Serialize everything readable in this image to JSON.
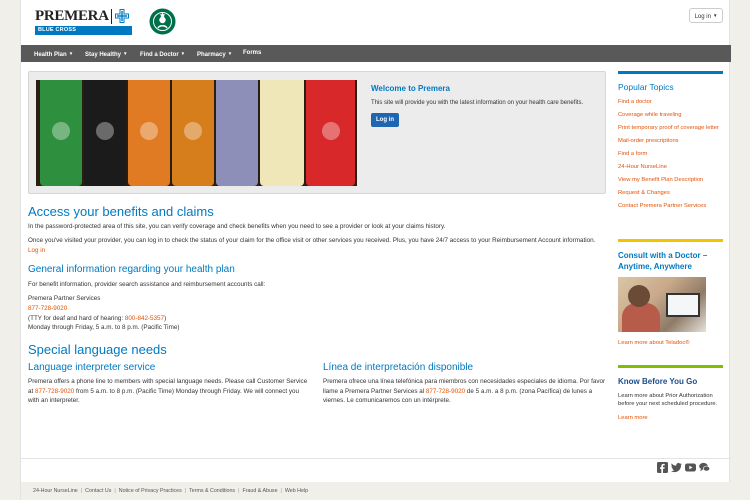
{
  "brand": {
    "name": "PREMERA",
    "band": "BLUE CROSS",
    "blue": "#0079c1",
    "orange": "#e35205",
    "partner_logo": "starbucks-logo"
  },
  "header": {
    "login_label": "Log in"
  },
  "nav": {
    "items": [
      {
        "label": "Health Plan",
        "has_caret": true
      },
      {
        "label": "Stay Healthy",
        "has_caret": true
      },
      {
        "label": "Find a Doctor",
        "has_caret": true
      },
      {
        "label": "Pharmacy",
        "has_caret": true
      },
      {
        "label": "Forms",
        "has_caret": false
      }
    ]
  },
  "hero": {
    "title": "Welcome to Premera",
    "text": "This site will provide you with the latest information on your health care benefits.",
    "button": "Log in"
  },
  "access": {
    "title": "Access your benefits and claims",
    "p1": "In the password-protected area of this site, you can verify coverage and check benefits when you need to see a provider or look at your claims history.",
    "p2": "Once you've visited your provider, you can log in to check the status of your claim for the office visit or other services you received. Plus, you have 24/7 access to your Reimbursement Account information.",
    "link": "Log in"
  },
  "general": {
    "title": "General information regarding your health plan",
    "intro": "For benefit information, provider search assistance and reimbursement accounts call:",
    "org": "Premera Partner Services",
    "phone": "877-728-9020",
    "tty_prefix": "(TTY for deaf and hard of hearing: ",
    "tty_phone": "800-842-5357",
    "tty_suffix": ")",
    "hours": "Monday through Friday, 5 a.m. to 8 p.m. (Pacific Time)"
  },
  "language": {
    "title": "Special language needs",
    "en_title": "Language interpreter service",
    "en_text_1": "Premera offers a phone line to members with special language needs. Please call Customer Service at ",
    "en_phone": "877-728-9020",
    "en_text_2": " from 5 a.m. to 8 p.m. (Pacific Time) Monday through Friday. We will connect you with an interpreter.",
    "es_title": "Línea de interpretación disponible",
    "es_text_1": "Premera ofrece una línea telefónica para miembros con necesidades especiales de idioma. Por favor llame a Premera Partner Services al ",
    "es_phone": "877-728-9020",
    "es_text_2": " de 5 a.m. a 8 p.m. (zona Pacífica) de lunes a viernes. Le comunicaremos con un intérprete."
  },
  "sidebar": {
    "popular_title": "Popular Topics",
    "topics": [
      "Find a doctor",
      "Coverage while traveling",
      "Print temporary proof of coverage letter",
      "Mail-order prescriptions",
      "Find a form",
      "24-Hour NurseLine",
      "View my Benefit Plan Description",
      "Request & Changes",
      "Contact Premera Partner Services"
    ],
    "teladoc_title": "Consult with a Doctor – Anytime, Anywhere",
    "teladoc_link": "Learn more about Teladoc®",
    "know_title": "Know Before You Go",
    "know_text": "Learn more about Prior Authorization before your next scheduled procedure.",
    "know_link": "Learn more"
  },
  "social": [
    "facebook-icon",
    "twitter-icon",
    "youtube-icon",
    "chat-icon"
  ],
  "footer": {
    "links": [
      "24-Hour NurseLine",
      "Contact Us",
      "Notice of Privacy Practices",
      "Terms & Conditions",
      "Fraud & Abuse",
      "Web Help"
    ]
  }
}
